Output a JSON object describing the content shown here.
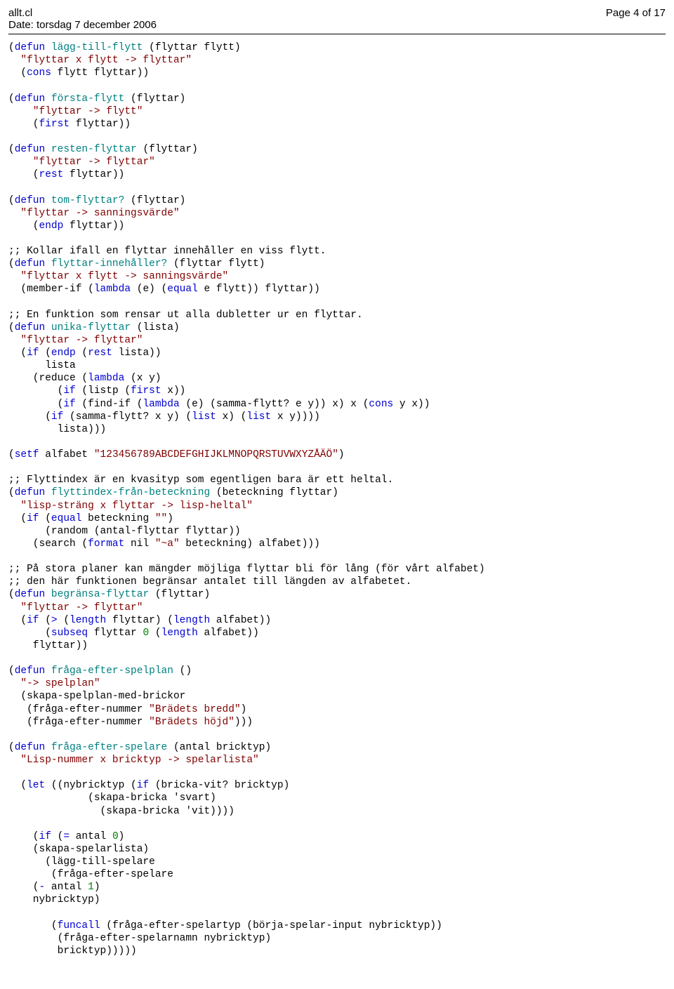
{
  "header": {
    "file": "allt.cl",
    "date": "Date: torsdag 7 december 2006",
    "page": "Page 4 of 17"
  },
  "tokens": [
    "(",
    "kw:defun",
    "fn:lägg-till-flytt",
    " (flyttar flytt)\n  ",
    "str:\"flyttar x flytt -> flyttar\"",
    "\n  (",
    "kw:cons",
    " flytt flyttar))\n\n",
    "(",
    "kw:defun",
    "fn:första-flytt",
    " (flyttar)\n    ",
    "str:\"flyttar -> flytt\"",
    "\n    (",
    "kw:first",
    " flyttar))\n\n",
    "(",
    "kw:defun",
    "fn:resten-flyttar",
    " (flyttar)\n    ",
    "str:\"flyttar -> flyttar\"",
    "\n    (",
    "kw:rest",
    " flyttar))\n\n",
    "(",
    "kw:defun",
    "fn:tom-flyttar?",
    " (flyttar)\n  ",
    "str:\"flyttar -> sanningsvärde\"",
    "\n    (",
    "kw:endp",
    " flyttar))\n\n",
    ";; Kollar ifall en flyttar innehåller en viss flytt.\n",
    "(",
    "kw:defun",
    "fn:flyttar-innehåller?",
    " (flyttar flytt)\n  ",
    "str:\"flyttar x flytt -> sanningsvärde\"",
    "\n  (member-if (",
    "kw:lambda",
    " (e) (",
    "kw:equal",
    " e flytt)) flyttar))\n\n",
    ";; En funktion som rensar ut alla dubletter ur en flyttar.\n",
    "(",
    "kw:defun",
    "fn:unika-flyttar",
    " (lista)\n  ",
    "str:\"flyttar -> flyttar\"",
    "\n  (",
    "kw:if",
    " (",
    "kw:endp",
    " (",
    "kw:rest",
    " lista))\n      lista\n    (reduce (",
    "kw:lambda",
    " (x y)\n        (",
    "kw:if",
    " (listp (",
    "kw:first",
    " x))\n        (",
    "kw:if",
    " (find-if (",
    "kw:lambda",
    " (e) (samma-flytt? e y)) x) x (",
    "kw:cons",
    " y x))\n      (",
    "kw:if",
    " (samma-flytt? x y) (",
    "kw:list",
    " x) (",
    "kw:list",
    " x y))))\n        lista)))\n\n",
    "(",
    "kw:setf",
    " alfabet ",
    "str:\"123456789ABCDEFGHIJKLMNOPQRSTUVWXYZÅÄÖ\"",
    ")\n\n",
    ";; Flyttindex är en kvasityp som egentligen bara är ett heltal.\n",
    "(",
    "kw:defun",
    "fn:flyttindex-från-beteckning",
    " (beteckning flyttar)\n  ",
    "str:\"lisp-sträng x flyttar -> lisp-heltal\"",
    "\n  (",
    "kw:if",
    " (",
    "kw:equal",
    " beteckning ",
    "str:\"\"",
    ")\n      (random (antal-flyttar flyttar))\n    (search (",
    "kw:format",
    " nil ",
    "str:\"~a\"",
    " beteckning) alfabet)))\n\n",
    ";; På stora planer kan mängder möjliga flyttar bli för lång (för vårt alfabet)\n;; den här funktionen begränsar antalet till längden av alfabetet.\n",
    "(",
    "kw:defun",
    "fn:begränsa-flyttar",
    " (flyttar)\n  ",
    "str:\"flyttar -> flyttar\"",
    "\n  (",
    "kw:if",
    " (",
    "kw:>",
    " (",
    "kw:length",
    " flyttar) (",
    "kw:length",
    " alfabet))\n      (",
    "kw:subseq",
    " flyttar ",
    "num:0",
    " (",
    "kw:length",
    " alfabet))\n    flyttar))\n\n",
    "(",
    "kw:defun",
    "fn:fråga-efter-spelplan",
    " ()\n  ",
    "str:\"-> spelplan\"",
    "\n  (skapa-spelplan-med-brickor\n   (fråga-efter-nummer ",
    "str:\"Brädets bredd\"",
    ")\n   (fråga-efter-nummer ",
    "str:\"Brädets höjd\"",
    ")))\n\n",
    "(",
    "kw:defun",
    "fn:fråga-efter-spelare",
    " (antal bricktyp)\n  ",
    "str:\"Lisp-nummer x bricktyp -> spelarlista\"",
    "\n\n  (",
    "kw:let",
    " ((nybricktyp (",
    "kw:if",
    " (bricka-vit? bricktyp)\n             (skapa-bricka 'svart)\n               (skapa-bricka 'vit))))\n\n    (",
    "kw:if",
    " (",
    "kw:=",
    " antal ",
    "num:0",
    ")\n    (skapa-spelarlista)\n      (lägg-till-spelare\n       (fråga-efter-spelare\n    (",
    "kw:-",
    " antal ",
    "num:1",
    ")\n    nybricktyp)\n\n       (",
    "kw:funcall",
    " (fråga-efter-spelartyp (börja-spelar-input nybricktyp))\n        (fråga-efter-spelarnamn nybricktyp)\n        bricktyp)))))"
  ]
}
